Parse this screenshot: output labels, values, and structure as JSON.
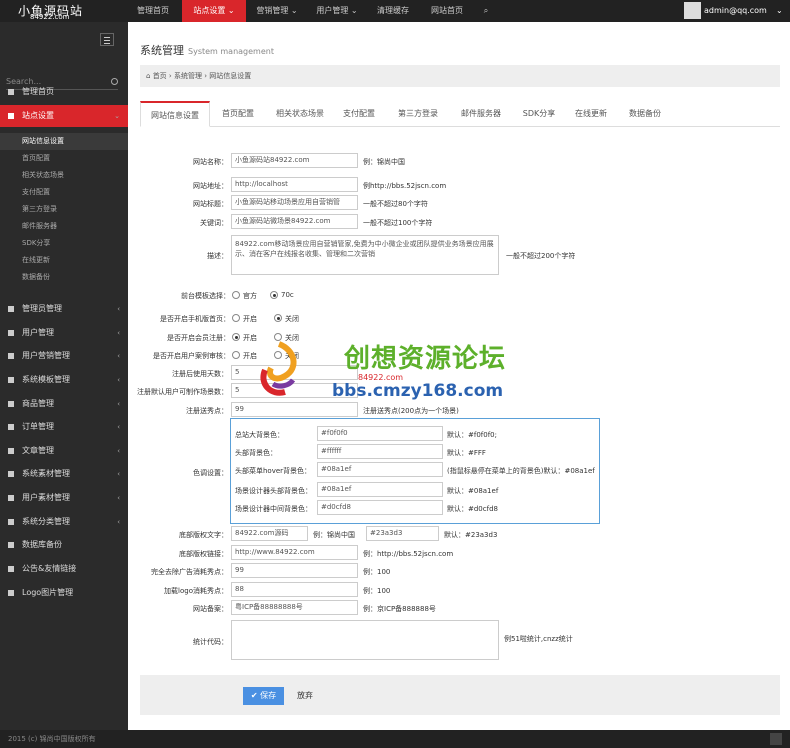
{
  "logo": {
    "title": "小鱼源码站",
    "domain": "84922.com"
  },
  "topnav": [
    "管理首页",
    "站点设置",
    "营销管理",
    "用户管理",
    "清理缓存",
    "网站首页"
  ],
  "user": {
    "email": "admin@qq.com"
  },
  "sidebar": {
    "search_placeholder": "Search...",
    "items": [
      {
        "label": "管理首页"
      },
      {
        "label": "站点设置"
      },
      {
        "label": "管理员管理"
      },
      {
        "label": "用户管理"
      },
      {
        "label": "用户营销管理"
      },
      {
        "label": "系统模板管理"
      },
      {
        "label": "商品管理"
      },
      {
        "label": "订单管理"
      },
      {
        "label": "文章管理"
      },
      {
        "label": "系统素材管理"
      },
      {
        "label": "用户素材管理"
      },
      {
        "label": "系统分类管理"
      },
      {
        "label": "数据库备份"
      },
      {
        "label": "公告&友情链接"
      },
      {
        "label": "Logo图片管理"
      }
    ],
    "subitems": [
      "网站信息设置",
      "首页配置",
      "相关状态场景",
      "支付配置",
      "第三方登录",
      "邮件服务器",
      "SDK分享",
      "在线更新",
      "数据备份"
    ]
  },
  "page": {
    "title": "系统管理",
    "subtitle": "System management"
  },
  "breadcrumb": [
    "首页",
    "系统管理",
    "网站信息设置"
  ],
  "tabs": [
    "网站信息设置",
    "首页配置",
    "相关状态场景",
    "支付配置",
    "第三方登录",
    "邮件服务器",
    "SDK分享",
    "在线更新",
    "数据备份"
  ],
  "form": {
    "site_name": {
      "label": "网站名称：",
      "value": "小鱼源码站84922.com",
      "hint": "例：锦尚中国"
    },
    "site_url": {
      "label": "网站地址：",
      "value": "http://localhost",
      "hint": "例http://bbs.52jscn.com"
    },
    "site_title": {
      "label": "网站标题：",
      "value": "小鱼源码站移动场景应用自营销管",
      "hint": "一般不超过80个字符"
    },
    "keywords": {
      "label": "关键词：",
      "value": "小鱼源码站微场景84922.com",
      "hint": "一般不超过100个字符"
    },
    "description": {
      "label": "描述：",
      "value": "84922.com移动场景应用自营销管家,免费为中小微企业或团队提供业务场景应用展示、消在客户在线报名收集、管理和二次营销",
      "hint": "一般不超过200个字符"
    },
    "template": {
      "label": "前台模板选择：",
      "options": [
        "官方",
        "70c"
      ],
      "selected": "70c"
    },
    "mobile_home": {
      "label": "是否开启手机版首页：",
      "options": [
        "开启",
        "关闭"
      ],
      "selected": "关闭"
    },
    "member_reg": {
      "label": "是否开启会员注册：",
      "options": [
        "开启",
        "关闭"
      ],
      "selected": "开启"
    },
    "user_case": {
      "label": "是否开启用户案例审核：",
      "options": [
        "开启",
        "关闭"
      ],
      "selected": ""
    },
    "trial_days": {
      "label": "注册后使用天数：",
      "value": "5"
    },
    "default_scenes": {
      "label": "注册默认用户可制作场景数：",
      "value": "5"
    },
    "scene_points": {
      "label": "注册送秀点：",
      "value": "99",
      "hint": "注册送秀点(200点为一个场景)"
    },
    "colors": {
      "label": "色调设置：",
      "rows": [
        {
          "label": "总站大背景色：",
          "value": "#f0f0f0",
          "hint": "默认：#f0f0f0;"
        },
        {
          "label": "头部背景色：",
          "value": "#ffffff",
          "hint": "默认：#FFF"
        },
        {
          "label": "头部菜单hover背景色：",
          "value": "#08a1ef",
          "hint": "(指鼠标悬停在菜单上的背景色)默认：#08a1ef"
        },
        {
          "label": "场景设计器头部背景色：",
          "value": "#08a1ef",
          "hint": "默认：#08a1ef"
        },
        {
          "label": "场景设计器中间背景色：",
          "value": "#d0cfd8",
          "hint": "默认：#d0cfd8"
        }
      ]
    },
    "footer_text": {
      "label": "底部版权文字：",
      "value": "84922.com源码",
      "hint": "例：锦尚中国",
      "color_value": "#23a3d3",
      "color_hint": "默认：#23a3d3"
    },
    "footer_link": {
      "label": "底部版权链接：",
      "value": "http://www.84922.com",
      "hint": "例：http://bbs.52jscn.com"
    },
    "remove_ad": {
      "label": "完全去除广告消耗秀点：",
      "value": "99",
      "hint": "例：100"
    },
    "add_logo": {
      "label": "加载logo消耗秀点：",
      "value": "88",
      "hint": "例：100"
    },
    "icp": {
      "label": "网站备案：",
      "value": "粤ICP备88888888号",
      "hint": "例：京ICP备888888号"
    },
    "stats_code": {
      "label": "统计代码：",
      "value": "",
      "hint": "例51啦统计,cnzz统计"
    }
  },
  "buttons": {
    "save": "保存",
    "cancel": "放弃"
  },
  "footer": {
    "copyright": "2015 (c) 锦尚中国版权所有"
  },
  "watermark": {
    "text": "创想资源论坛",
    "url": "bbs.cmzy168.com",
    "domain": "84922.com"
  }
}
